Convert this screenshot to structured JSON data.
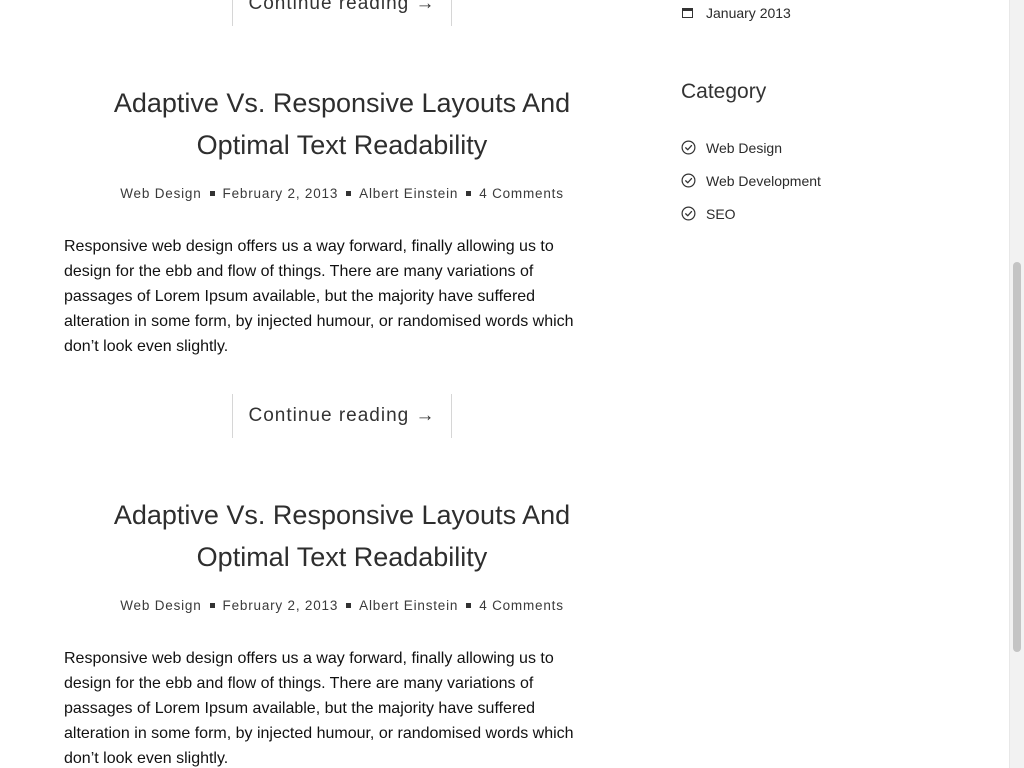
{
  "posts": [
    {
      "continue_label": "Continue reading →"
    },
    {
      "title_line1": "Adaptive Vs. Responsive Layouts And",
      "title_line2": "Optimal Text Readability",
      "meta": {
        "category": "Web Design",
        "date": "February 2, 2013",
        "author": "Albert Einstein",
        "comments": "4 Comments"
      },
      "excerpt": "Responsive web design offers us a way forward, finally allowing us to design for the ebb and flow of things. There are many variations of passages of Lorem Ipsum available, but the majority have suffered alteration in some form, by injected humour, or randomised words which don’t look even slightly.",
      "continue_label": "Continue reading →"
    },
    {
      "title_line1": "Adaptive Vs. Responsive Layouts And",
      "title_line2": "Optimal Text Readability",
      "meta": {
        "category": "Web Design",
        "date": "February 2, 2013",
        "author": "Albert Einstein",
        "comments": "4 Comments"
      },
      "excerpt": "Responsive web design offers us a way forward, finally allowing us to design for the ebb and flow of things. There are many variations of passages of Lorem Ipsum available, but the majority have suffered alteration in some form, by injected humour, or randomised words which don’t look even slightly."
    }
  ],
  "sidebar": {
    "archive": {
      "icon": "calendar-icon",
      "label": "January 2013"
    },
    "category_title": "Category",
    "categories": [
      {
        "icon": "check-circle-icon",
        "label": "Web Design"
      },
      {
        "icon": "check-circle-icon",
        "label": "Web Development"
      },
      {
        "icon": "check-circle-icon",
        "label": "SEO"
      }
    ]
  },
  "colors": {
    "text": "#2b2b2b",
    "divider": "#d6d6d6",
    "scroll_thumb": "#c4c4c4"
  }
}
